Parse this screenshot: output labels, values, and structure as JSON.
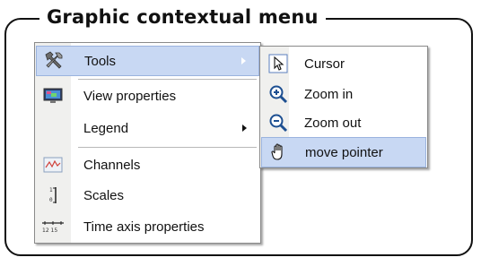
{
  "frame": {
    "title": "Graphic contextual menu"
  },
  "main_menu": {
    "items": [
      {
        "label": "Tools",
        "icon": "tools-icon",
        "has_submenu": true,
        "highlighted": true
      },
      {
        "label": "View properties",
        "icon": "monitor-icon",
        "has_submenu": false
      },
      {
        "label": "Legend",
        "icon": "",
        "has_submenu": true
      },
      {
        "label": "Channels",
        "icon": "channels-icon",
        "has_submenu": false
      },
      {
        "label": "Scales",
        "icon": "scales-icon",
        "has_submenu": false
      },
      {
        "label": "Time axis properties",
        "icon": "time-axis-icon",
        "has_submenu": false
      }
    ]
  },
  "sub_menu": {
    "items": [
      {
        "label": "Cursor",
        "icon": "cursor-icon"
      },
      {
        "label": "Zoom in",
        "icon": "zoom-in-icon"
      },
      {
        "label": "Zoom out",
        "icon": "zoom-out-icon"
      },
      {
        "label": "move pointer",
        "icon": "hand-icon",
        "highlighted": true
      }
    ]
  },
  "colors": {
    "highlight": "#c8d8f3",
    "highlight_border": "#9ab3de",
    "icon_strip": "#f0f0ee"
  },
  "time_axis_icon_text": "12 15"
}
